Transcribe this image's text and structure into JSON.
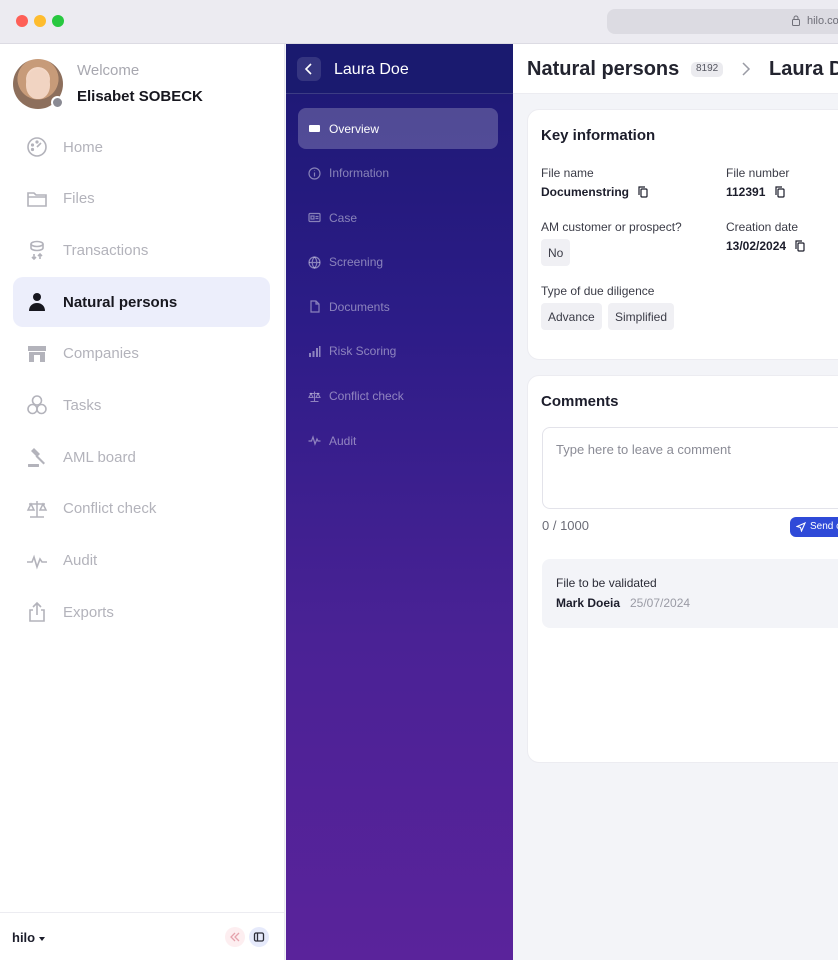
{
  "browser": {
    "url": "hilo.co"
  },
  "user": {
    "welcome": "Welcome",
    "name": "Elisabet SOBECK"
  },
  "sidebar": {
    "items": [
      {
        "label": "Home",
        "icon": "dashboard-icon"
      },
      {
        "label": "Files",
        "icon": "folder-icon"
      },
      {
        "label": "Transactions",
        "icon": "coins-icon"
      },
      {
        "label": "Natural persons",
        "icon": "person-icon",
        "active": true
      },
      {
        "label": "Companies",
        "icon": "store-icon"
      },
      {
        "label": "Tasks",
        "icon": "circles-icon"
      },
      {
        "label": "AML board",
        "icon": "gavel-icon"
      },
      {
        "label": "Conflict check",
        "icon": "scale-icon"
      },
      {
        "label": "Audit",
        "icon": "pulse-icon"
      },
      {
        "label": "Exports",
        "icon": "export-icon"
      }
    ],
    "brand": "hilo"
  },
  "subnav": {
    "title": "Laura Doe",
    "items": [
      {
        "label": "Overview",
        "icon": "monitor-icon",
        "active": true
      },
      {
        "label": "Information",
        "icon": "info-icon"
      },
      {
        "label": "Case",
        "icon": "id-card-icon"
      },
      {
        "label": "Screening",
        "icon": "globe-icon"
      },
      {
        "label": "Documents",
        "icon": "document-icon"
      },
      {
        "label": "Risk Scoring",
        "icon": "bar-chart-icon"
      },
      {
        "label": "Conflict check",
        "icon": "scale-icon"
      },
      {
        "label": "Audit",
        "icon": "pulse-icon"
      }
    ]
  },
  "main": {
    "breadcrumb": {
      "section": "Natural persons",
      "count": "8192",
      "current": "Laura D"
    },
    "key_info": {
      "title": "Key information",
      "file_name_label": "File name",
      "file_name_value": "Documenstring",
      "file_number_label": "File number",
      "file_number_value": "112391",
      "am_label": "AM customer or prospect?",
      "am_value": "No",
      "creation_label": "Creation date",
      "creation_value": "13/02/2024",
      "dd_label": "Type of due diligence",
      "dd_values": [
        "Advance",
        "Simplified"
      ]
    },
    "comments": {
      "title": "Comments",
      "placeholder": "Type here to leave a comment",
      "counter": "0 / 1000",
      "send_label": "Send c",
      "history": {
        "title": "File to be validated",
        "author": "Mark Doeia",
        "date": "25/07/2024",
        "mark": "^"
      }
    }
  },
  "colors": {
    "accent": "#2f4ad8",
    "subnav_top": "#1c1873",
    "subnav_bottom": "#5a239b",
    "active_nav_bg": "#eceefb"
  }
}
